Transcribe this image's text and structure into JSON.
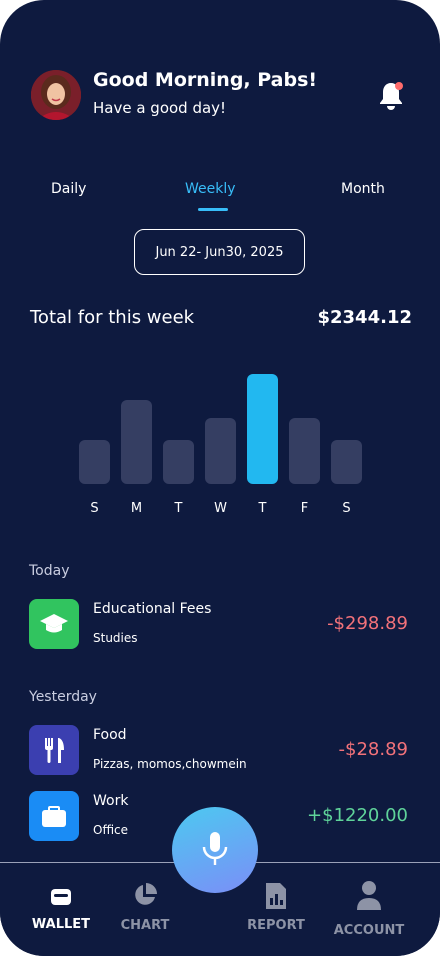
{
  "header": {
    "greeting": "Good Morning, Pabs!",
    "subtitle": "Have a good day!"
  },
  "tabs": [
    {
      "label": "Daily",
      "active": false
    },
    {
      "label": "Weekly",
      "active": true
    },
    {
      "label": "Month",
      "active": false
    }
  ],
  "date_range": "Jun 22- Jun30, 2025",
  "summary": {
    "label": "Total for this week",
    "total": "$2344.12"
  },
  "chart_data": {
    "type": "bar",
    "categories": [
      "S",
      "M",
      "T",
      "W",
      "T",
      "F",
      "S"
    ],
    "values": [
      0.4,
      0.76,
      0.4,
      0.6,
      1.0,
      0.6,
      0.4
    ],
    "highlighted_index": 4,
    "colors": {
      "bar": "#353e62",
      "highlight": "#22b8f0"
    }
  },
  "transactions": {
    "today_label": "Today",
    "yesterday_label": "Yesterday",
    "today": [
      {
        "title": "Educational Fees",
        "category": "Studies",
        "amount": "-$298.89",
        "icon": "graduation-cap-icon",
        "color": "#31c45f"
      }
    ],
    "yesterday": [
      {
        "title": "Food",
        "category": "Pizzas, momos,chowmein",
        "amount": "-$28.89",
        "icon": "fork-knife-icon",
        "color": "#3b3fb0"
      },
      {
        "title": "Work",
        "category": "Office",
        "amount": "+$1220.00",
        "icon": "briefcase-icon",
        "color": "#1a8cf5"
      }
    ]
  },
  "nav": {
    "wallet": "WALLET",
    "chart": "CHART",
    "report": "REPORT",
    "account": "ACCOUNT"
  },
  "colors": {
    "background": "#0e1a3f",
    "accent": "#38bdf8",
    "negative": "#f2727a",
    "positive": "#5fd39a"
  }
}
